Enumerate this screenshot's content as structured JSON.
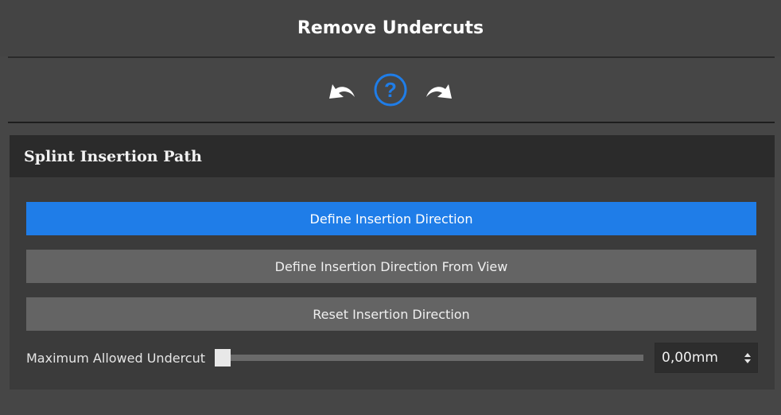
{
  "title": "Remove Undercuts",
  "toolbar": {
    "icons": [
      "undo-icon",
      "help-icon",
      "redo-icon"
    ],
    "accent": "#1f7de8"
  },
  "panel": {
    "header": "Splint Insertion Path",
    "buttons": [
      {
        "label": "Define Insertion Direction",
        "active": true
      },
      {
        "label": "Define Insertion Direction From View",
        "active": false
      },
      {
        "label": "Reset Insertion Direction",
        "active": false
      }
    ],
    "undercut": {
      "label": "Maximum Allowed Undercut",
      "value": "0,00mm",
      "slider_fraction": 0.0
    }
  },
  "colors": {
    "background": "#464646",
    "panel": "#3b3b3b",
    "header": "#2b2b2b",
    "button": "#646464",
    "primary_button": "#1f7de8"
  }
}
